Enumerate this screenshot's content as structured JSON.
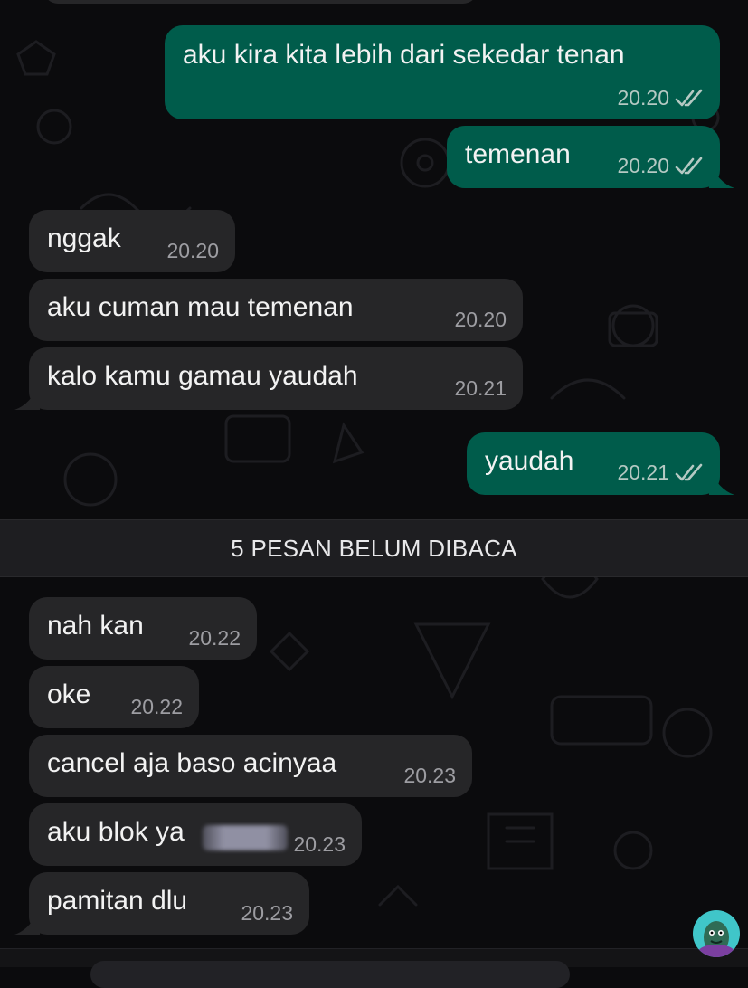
{
  "colors": {
    "background": "#0b0b0d",
    "incoming_bubble": "#262628",
    "outgoing_bubble": "#005c4b",
    "read_ticks": "#b5c9c3",
    "timestamp": "#9d9da2"
  },
  "unread_divider": "5 PESAN BELUM DIBACA",
  "messages": [
    {
      "direction": "out",
      "text": "aku kira kita lebih dari sekedar tenan",
      "time": "20.20",
      "status": "read-double-tick-icon"
    },
    {
      "direction": "out",
      "text": "temenan",
      "time": "20.20",
      "status": "read-double-tick-icon"
    },
    {
      "direction": "in",
      "text": "nggak",
      "time": "20.20"
    },
    {
      "direction": "in",
      "text": "aku cuman mau temenan",
      "time": "20.20"
    },
    {
      "direction": "in",
      "text": "kalo kamu gamau yaudah",
      "time": "20.21"
    },
    {
      "direction": "out",
      "text": "yaudah",
      "time": "20.21",
      "status": "read-double-tick-icon"
    },
    {
      "direction": "in",
      "text": "nah kan",
      "time": "20.22"
    },
    {
      "direction": "in",
      "text": "oke",
      "time": "20.22"
    },
    {
      "direction": "in",
      "text": "cancel aja baso acinyaa",
      "time": "20.23"
    },
    {
      "direction": "in",
      "text": "aku blok ya",
      "time": "20.23",
      "redacted_suffix": true
    },
    {
      "direction": "in",
      "text": "pamitan dlu",
      "time": "20.23"
    }
  ],
  "overlay": {
    "avatar_icon": "cartoon-avatar-icon"
  }
}
